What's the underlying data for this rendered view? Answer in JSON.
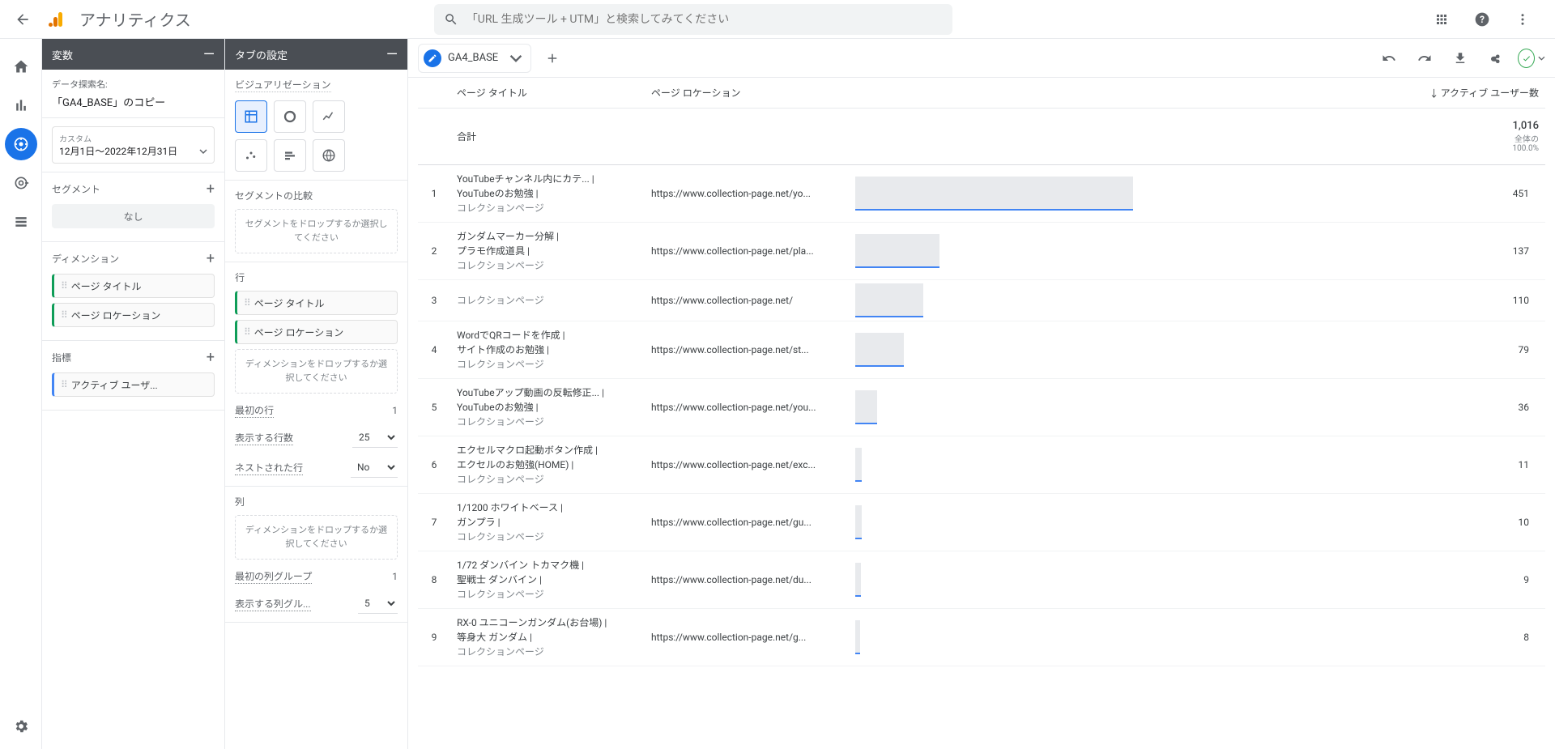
{
  "app_title": "アナリティクス",
  "search": {
    "placeholder": "「URL 生成ツール + UTM」と検索してみてください"
  },
  "variables_panel": {
    "title": "変数",
    "exploration_name_label": "データ探索名:",
    "exploration_name": "「GA4_BASE」のコピー",
    "date": {
      "label": "カスタム",
      "range": "12月1日～2022年12月31日"
    },
    "segments": {
      "title": "セグメント",
      "none": "なし"
    },
    "dimensions": {
      "title": "ディメンション",
      "items": [
        "ページ タイトル",
        "ページ ロケーション"
      ]
    },
    "metrics": {
      "title": "指標",
      "items": [
        "アクティブ ユーザ..."
      ]
    }
  },
  "settings_panel": {
    "title": "タブの設定",
    "viz_label": "ビジュアリゼーション",
    "segment_compare": {
      "title": "セグメントの比較",
      "drop": "セグメントをドロップするか選択してください"
    },
    "rows": {
      "title": "行",
      "items": [
        "ページ タイトル",
        "ページ ロケーション"
      ],
      "drop": "ディメンションをドロップするか選択してください",
      "start_label": "最初の行",
      "start_value": "1",
      "show_label": "表示する行数",
      "show_value": "25",
      "nested_label": "ネストされた行",
      "nested_value": "No"
    },
    "cols": {
      "title": "列",
      "drop": "ディメンションをドロップするか選択してください",
      "start_group_label": "最初の列グループ",
      "start_group_value": "1",
      "show_group_label": "表示する列グル...",
      "show_group_value": "5"
    }
  },
  "report": {
    "tab_label": "GA4_BASE",
    "headers": {
      "page_title": "ページ タイトル",
      "page_location": "ページ ロケーション",
      "metric": "アクティブ ユーザー数"
    },
    "total_label": "合計",
    "total_value": "1,016",
    "total_pct": "全体の 100.0%",
    "max_value": 1016,
    "rows": [
      {
        "idx": 1,
        "title": "YouTubeチャンネル内にカテ... | YouTubeのお勉強 | コレクションページ",
        "loc": "https://www.collection-page.net/yo...",
        "val": 451
      },
      {
        "idx": 2,
        "title": "ガンダムマーカー分解 | プラモ作成道具 | コレクションページ",
        "loc": "https://www.collection-page.net/pla...",
        "val": 137
      },
      {
        "idx": 3,
        "title": "コレクションページ",
        "loc": "https://www.collection-page.net/",
        "val": 110
      },
      {
        "idx": 4,
        "title": "WordでQRコードを作成 | サイト作成のお勉強 | コレクションページ",
        "loc": "https://www.collection-page.net/st...",
        "val": 79
      },
      {
        "idx": 5,
        "title": "YouTubeアップ動画の反転修正... | YouTubeのお勉強 | コレクションページ",
        "loc": "https://www.collection-page.net/you...",
        "val": 36
      },
      {
        "idx": 6,
        "title": "エクセルマクロ起動ボタン作成 | エクセルのお勉強(HOME) | コレクションページ",
        "loc": "https://www.collection-page.net/exc...",
        "val": 11
      },
      {
        "idx": 7,
        "title": "1/1200 ホワイトベース | ガンプラ | コレクションページ",
        "loc": "https://www.collection-page.net/gu...",
        "val": 10
      },
      {
        "idx": 8,
        "title": "1/72 ダンバイン トカマク機 | 聖戦士 ダンバイン | コレクションページ",
        "loc": "https://www.collection-page.net/du...",
        "val": 9
      },
      {
        "idx": 9,
        "title": "RX-0 ユニコーンガンダム(お台場) | 等身大 ガンダム | コレクションページ",
        "loc": "https://www.collection-page.net/g...",
        "val": 8
      }
    ]
  },
  "chart_data": {
    "type": "bar",
    "title": "アクティブ ユーザー数",
    "categories": [
      "Row 1",
      "Row 2",
      "Row 3",
      "Row 4",
      "Row 5",
      "Row 6",
      "Row 7",
      "Row 8",
      "Row 9"
    ],
    "values": [
      451,
      137,
      110,
      79,
      36,
      11,
      10,
      9,
      8
    ],
    "total": 1016,
    "xlabel": "",
    "ylabel": "アクティブ ユーザー数"
  }
}
